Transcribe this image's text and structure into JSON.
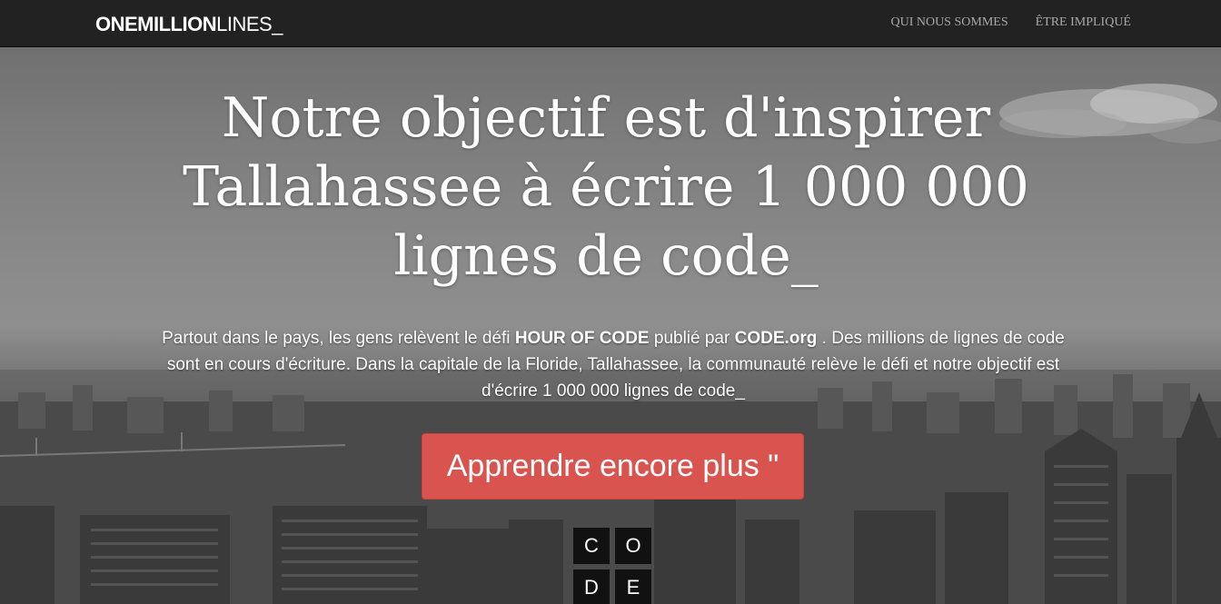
{
  "navbar": {
    "brand_bold": "ONEMILLION",
    "brand_light": "LINES_",
    "links": [
      {
        "label": "QUI NOUS SOMMES"
      },
      {
        "label": "ÊTRE IMPLIQUÉ"
      }
    ]
  },
  "hero": {
    "headline": "Notre objectif est d'inspirer Tallahassee à écrire 1 000 000 lignes de code_",
    "lead": {
      "part1": "Partout dans le pays, les gens relèvent le défi ",
      "hoc": "HOUR OF CODE",
      "part2": " publié par ",
      "codeorg": "CODE.org",
      "part3": " . Des millions de lignes de code sont en cours d'écriture. Dans la capitale de la Floride, Tallahassee, la communauté relève le défi et notre objectif est d'écrire 1 000 000 lignes de code_"
    },
    "cta_label": "Apprendre encore plus \"",
    "code_logo": {
      "letters": [
        "C",
        "O",
        "D",
        "E"
      ]
    }
  },
  "colors": {
    "navbar_bg": "#222222",
    "cta_bg": "#d9534f",
    "text_white": "#ffffff",
    "nav_link": "#a9a9a9"
  }
}
